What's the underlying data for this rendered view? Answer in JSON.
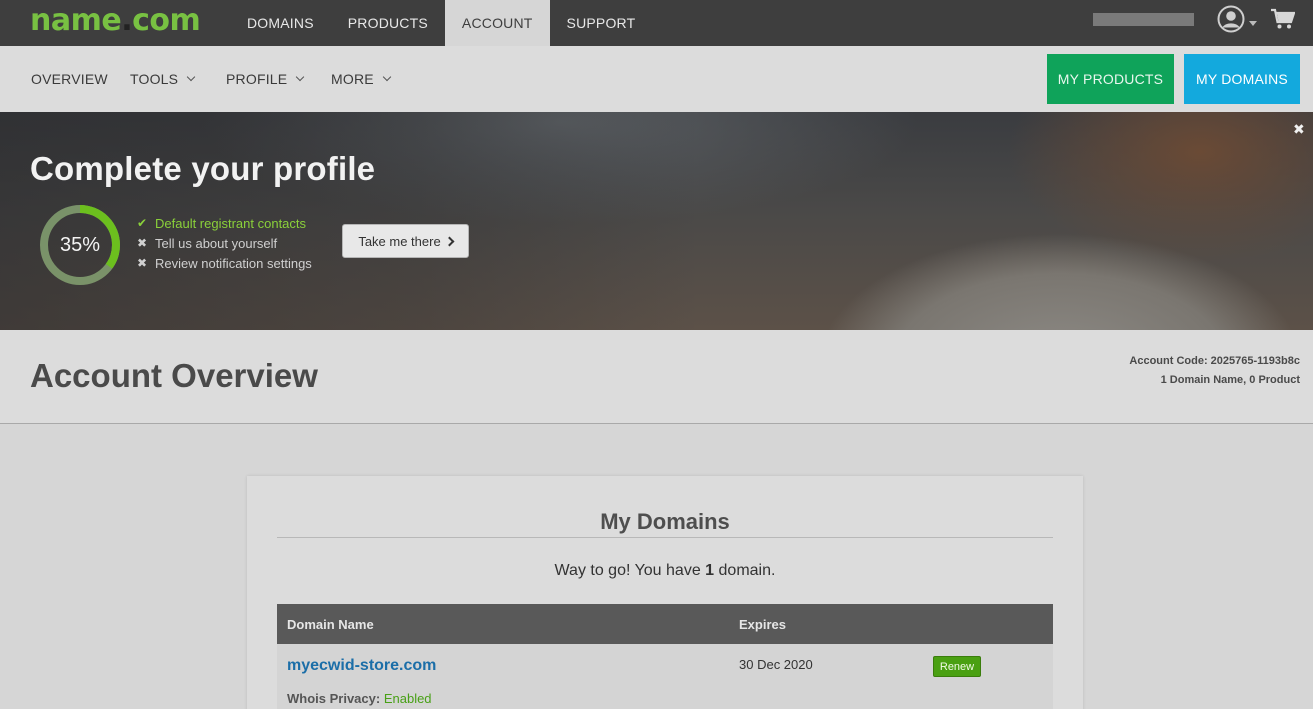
{
  "brand": {
    "name": "name",
    "dot": ".",
    "tld": "com"
  },
  "topnav": {
    "items": [
      "DOMAINS",
      "PRODUCTS",
      "ACCOUNT",
      "SUPPORT"
    ],
    "active": "ACCOUNT"
  },
  "icons": {
    "user": "user-circle-icon",
    "cart": "cart-icon",
    "close": "close-icon",
    "check": "checkmark-icon",
    "cross": "x-icon"
  },
  "subnav": {
    "items": [
      "OVERVIEW",
      "TOOLS",
      "PROFILE",
      "MORE"
    ],
    "my_products": "MY PRODUCTS",
    "my_domains": "MY DOMAINS"
  },
  "banner": {
    "title": "Complete your profile",
    "progress_label": "35%",
    "progress_fraction": 0.35,
    "tasks": [
      {
        "label": "Default registrant contacts",
        "done": true
      },
      {
        "label": "Tell us about yourself",
        "done": false
      },
      {
        "label": "Review notification settings",
        "done": false
      }
    ],
    "cta": "Take me there"
  },
  "account": {
    "title": "Account Overview",
    "code_label": "Account Code: 2025765-1193b8c",
    "summary": "1 Domain Name, 0 Product"
  },
  "domains_card": {
    "title": "My Domains",
    "subtitle_prefix": "Way to go! You have",
    "subtitle_count": "1",
    "subtitle_suffix": "domain.",
    "columns": [
      "Domain Name",
      "Expires"
    ],
    "rows": [
      {
        "domain": "myecwid-store.com",
        "expires": "30 Dec 2020",
        "renew": "Renew",
        "whois_label": "Whois Privacy:",
        "whois_value": "Enabled"
      }
    ]
  },
  "colors": {
    "brand_green": "#78c142",
    "products_btn": "#0fa35a",
    "domains_btn": "#13a9dd",
    "progress_green": "#6cbf1e",
    "link_blue": "#1b6ea8"
  }
}
